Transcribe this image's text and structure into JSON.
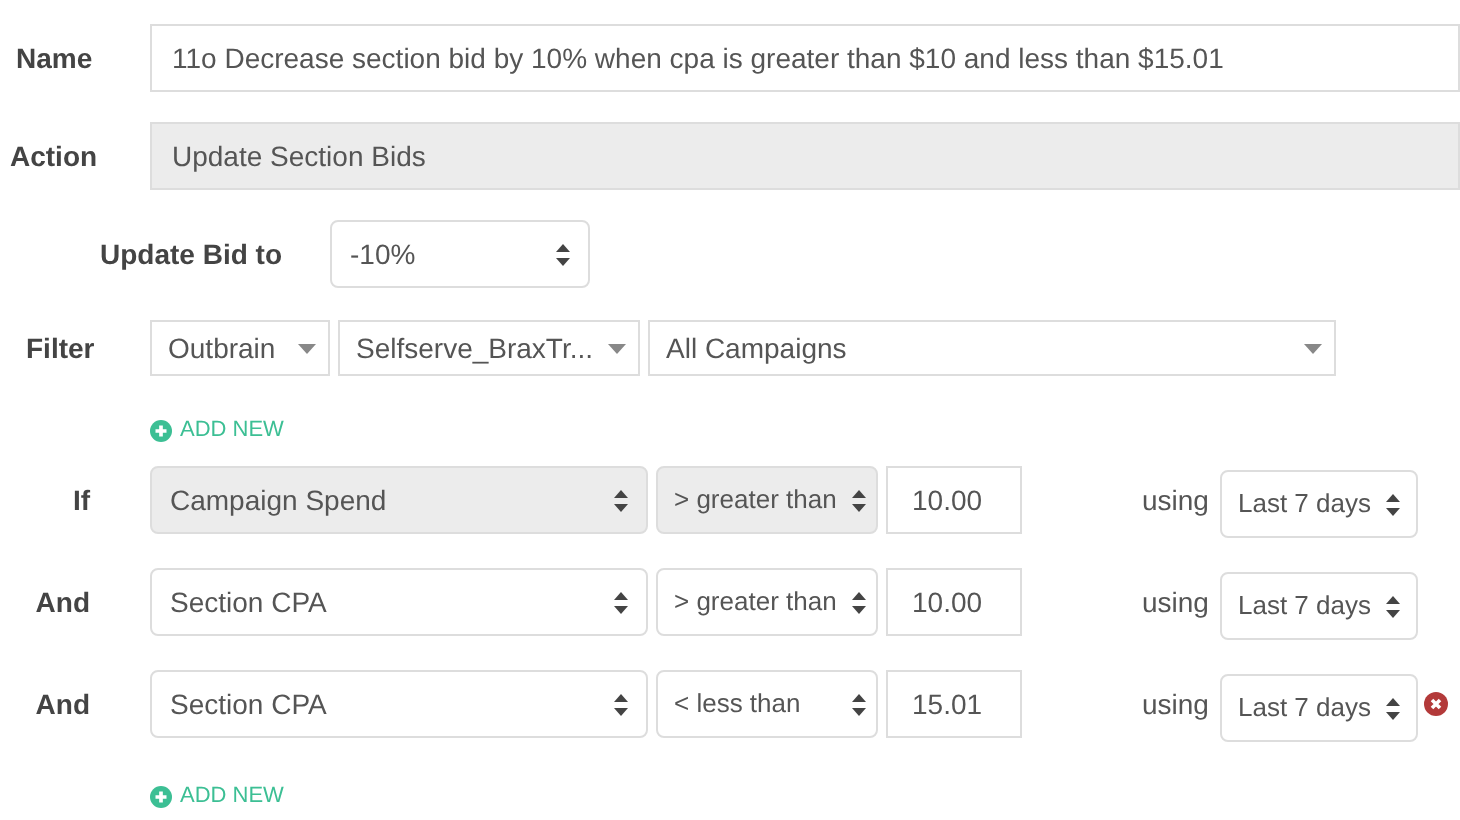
{
  "name": {
    "label": "Name",
    "value": "11o Decrease section bid by 10% when cpa is greater than $10 and less than $15.01"
  },
  "action": {
    "label": "Action",
    "value": "Update Section Bids"
  },
  "update_bid": {
    "label": "Update Bid to",
    "value": "-10%"
  },
  "filter": {
    "label": "Filter",
    "selects": [
      "Outbrain",
      "Selfserve_BraxTr...",
      "All Campaigns"
    ],
    "add_new": "ADD NEW"
  },
  "conditions": [
    {
      "label": "If",
      "field": "Campaign Spend",
      "operator": "> greater than",
      "value": "10.00",
      "using": "using",
      "period": "Last 7 days",
      "disabled": true,
      "removable": false
    },
    {
      "label": "And",
      "field": "Section CPA",
      "operator": "> greater than",
      "value": "10.00",
      "using": "using",
      "period": "Last 7 days",
      "disabled": false,
      "removable": false
    },
    {
      "label": "And",
      "field": "Section CPA",
      "operator": "< less than",
      "value": "15.01",
      "using": "using",
      "period": "Last 7 days",
      "disabled": false,
      "removable": true
    }
  ],
  "conditions_add_new": "ADD NEW"
}
